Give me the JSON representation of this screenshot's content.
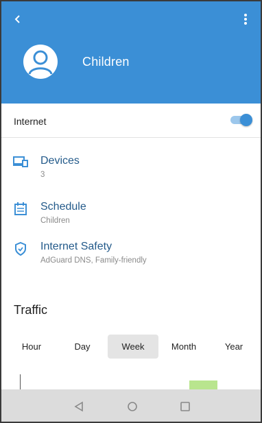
{
  "header": {
    "profile_name": "Children",
    "back_icon": "chevron-left-icon",
    "menu_icon": "more-vert-icon",
    "color": "#3b8fd6"
  },
  "internet": {
    "label": "Internet",
    "enabled": true
  },
  "items": [
    {
      "title": "Devices",
      "subtitle": "3",
      "icon": "devices-icon"
    },
    {
      "title": "Schedule",
      "subtitle": "Children",
      "icon": "calendar-icon"
    },
    {
      "title": "Internet Safety",
      "subtitle": "AdGuard DNS, Family-friendly",
      "icon": "shield-icon"
    }
  ],
  "traffic": {
    "title": "Traffic",
    "tabs": [
      "Hour",
      "Day",
      "Week",
      "Month",
      "Year"
    ],
    "active_tab": "Week"
  },
  "navbar": {
    "buttons": [
      "back-triangle-icon",
      "home-circle-icon",
      "recents-square-icon"
    ]
  }
}
